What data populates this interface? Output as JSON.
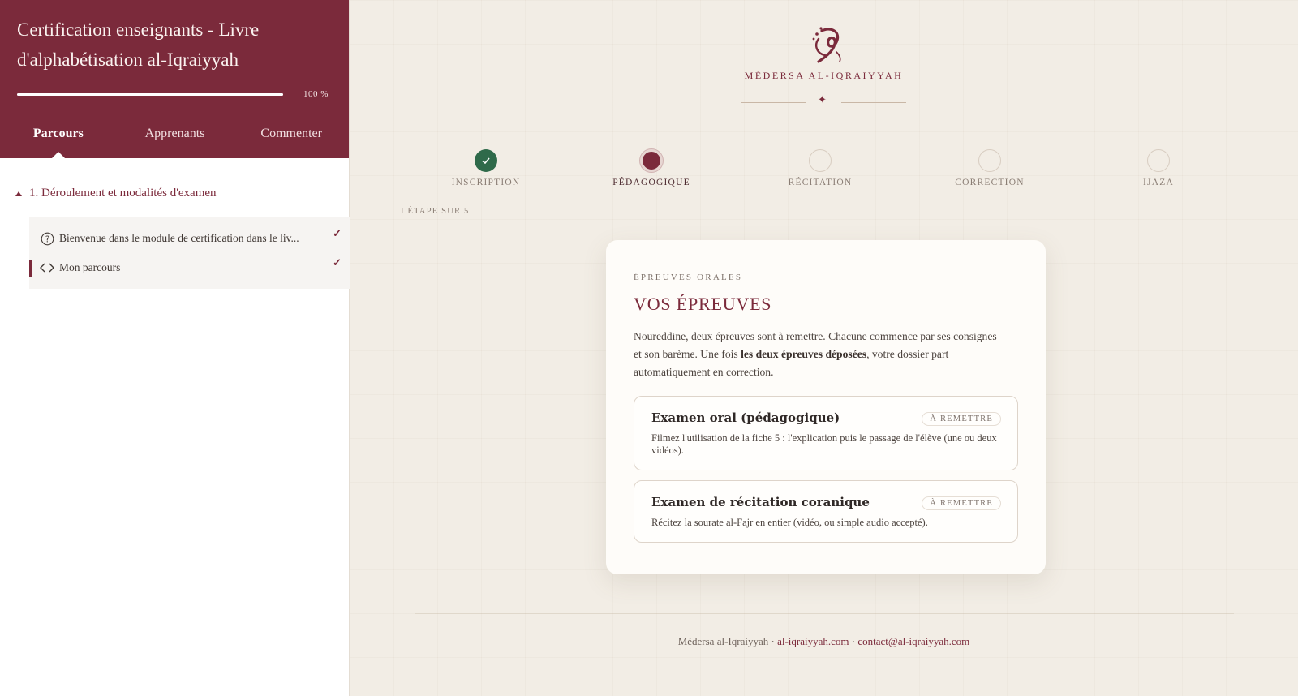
{
  "sidebar": {
    "course_title": "Certification enseignants - Livre d'alphabétisation al-Iqraiyyah",
    "progress": {
      "percent": 100,
      "label": "100 %"
    },
    "tabs": [
      {
        "label": "Parcours",
        "active": true
      },
      {
        "label": "Apprenants",
        "active": false
      },
      {
        "label": "Commenter",
        "active": false
      }
    ],
    "section": {
      "title": "1. Déroulement et modalités d'examen"
    },
    "lessons": [
      {
        "label": "Bienvenue dans le module de certification dans le liv...",
        "icon": "question-circle-icon",
        "done": true,
        "check": "✓"
      },
      {
        "label": "Mon parcours",
        "icon": "code-icon",
        "done": true,
        "current": true,
        "check": "✓"
      }
    ]
  },
  "brand": {
    "name": "Médersa al-Iqraiyyah",
    "display_name": "MÉDERSA AL-IQRAIYYAH",
    "divider_glyph": "✦"
  },
  "stepper": {
    "steps": [
      {
        "label": "INSCRIPTION",
        "state": "done"
      },
      {
        "label": "PÉDAGOGIQUE",
        "state": "current"
      },
      {
        "label": "RÉCITATION",
        "state": "todo"
      },
      {
        "label": "CORRECTION",
        "state": "todo"
      },
      {
        "label": "IJAZA",
        "state": "todo"
      }
    ],
    "count_label": "I ÉTAPE SUR 5"
  },
  "card": {
    "eyebrow": "ÉPREUVES ORALES",
    "title": "VOS ÉPREUVES",
    "desc_before": "Noureddine, deux épreuves sont à remettre. Chacune commence par ses consignes et son barème. Une fois ",
    "desc_bold": "les deux épreuves déposées",
    "desc_after": ", votre dossier part automatiquement en correction.",
    "exams": [
      {
        "title": "Examen oral (pédagogique)",
        "badge": "À REMETTRE",
        "text": "Filmez l'utilisation de la fiche 5 : l'explication puis le passage de l'élève (une ou deux vidéos)."
      },
      {
        "title": "Examen de récitation coranique",
        "badge": "À REMETTRE",
        "text": "Récitez la sourate al-Fajr en entier (vidéo, ou simple audio accepté)."
      }
    ]
  },
  "footer": {
    "brand": "Médersa al-Iqraiyyah",
    "separator": " · ",
    "site": "al-iqraiyyah.com",
    "email": "contact@al-iqraiyyah.com"
  },
  "colors": {
    "brand": "#7b2a3b",
    "success": "#2f6a4a",
    "background": "#f2ede5"
  }
}
